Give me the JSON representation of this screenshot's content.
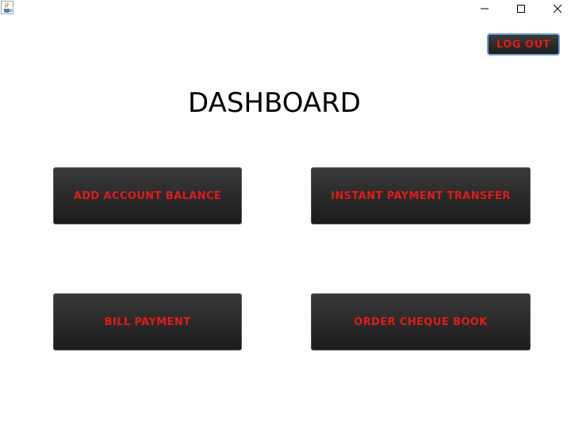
{
  "window": {
    "app_icon": "java-coffee-icon",
    "controls": {
      "minimize_icon": "minimize-icon",
      "maximize_icon": "maximize-icon",
      "close_icon": "close-icon"
    }
  },
  "header": {
    "logout_label": "LOG OUT"
  },
  "main": {
    "title": "DASHBOARD",
    "buttons": {
      "add_balance": "ADD ACCOUNT BALANCE",
      "instant_transfer": "INSTANT PAYMENT TRANSFER",
      "bill_payment": "BILL PAYMENT",
      "order_cheque": "ORDER CHEQUE BOOK"
    }
  },
  "colors": {
    "button_text": "#e01b1b",
    "button_bg": "#2a2a2a",
    "logout_border": "#6b9fd1",
    "background": "#ffffff"
  }
}
